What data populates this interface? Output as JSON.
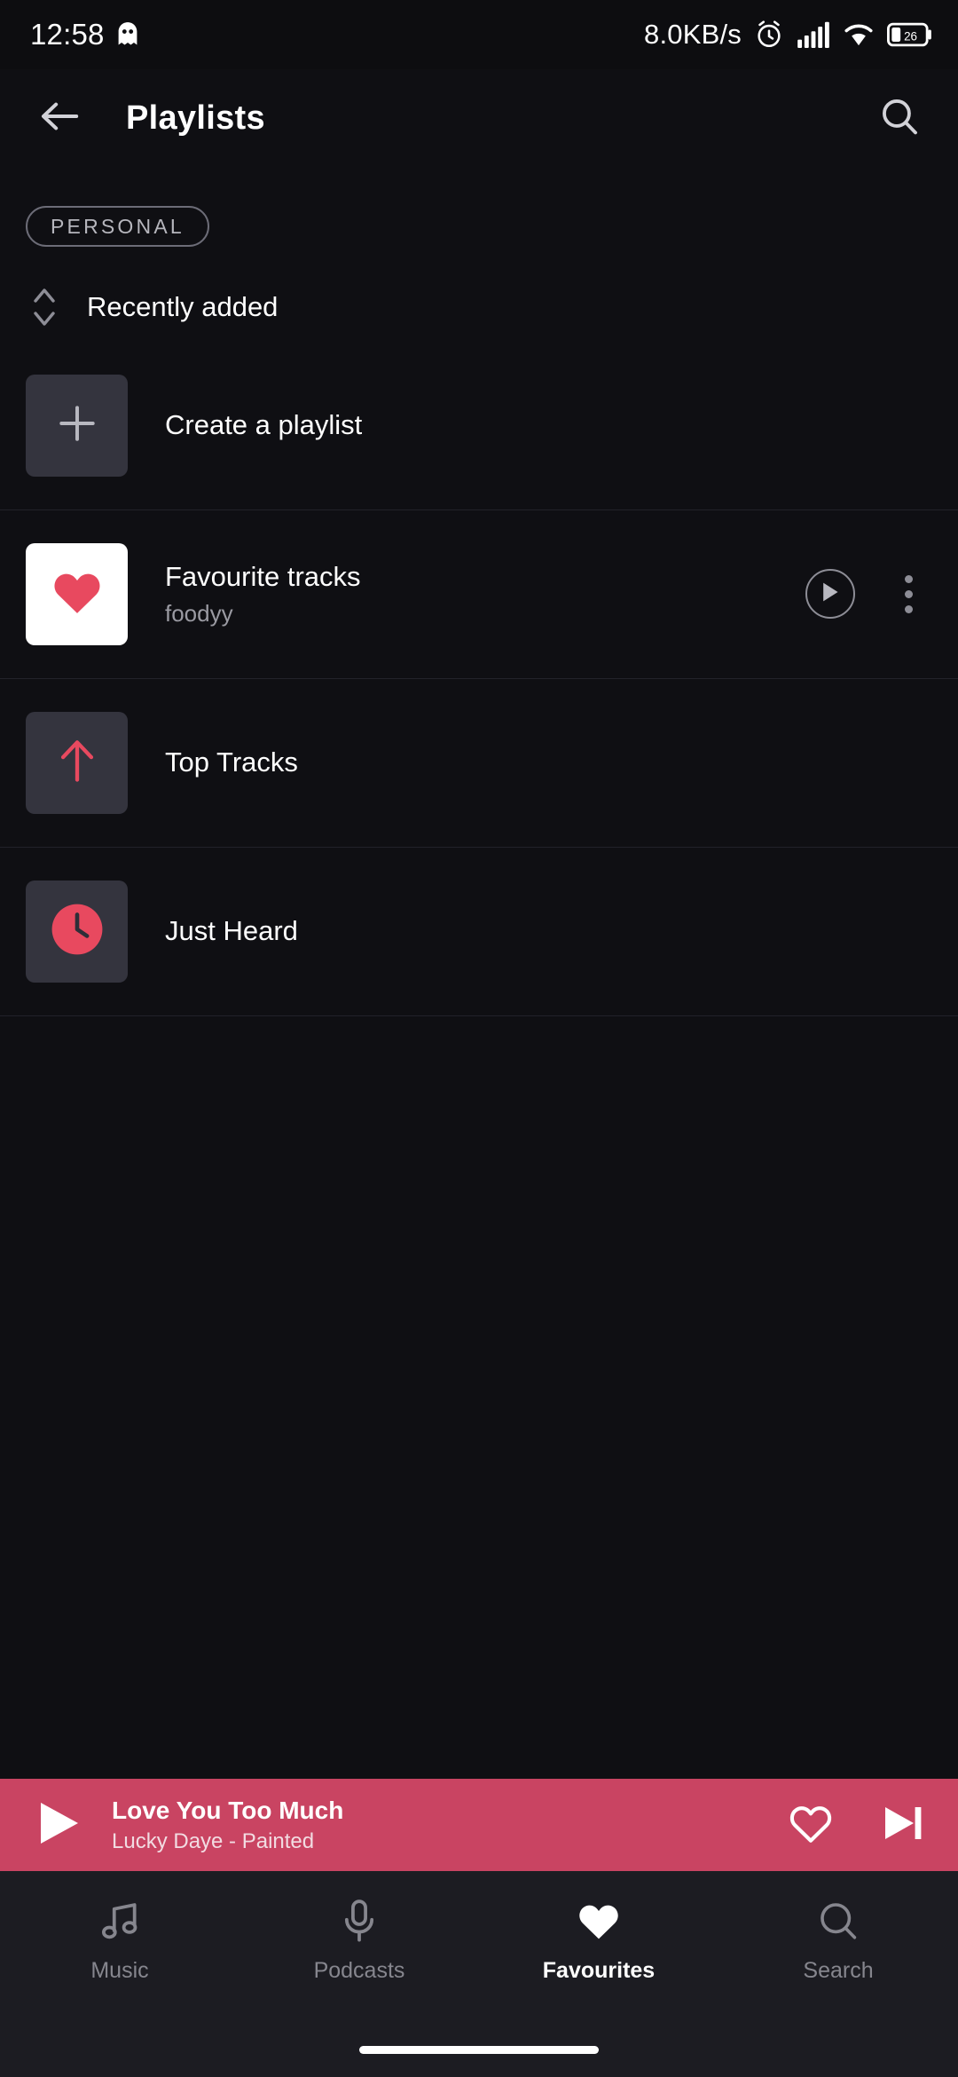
{
  "status_bar": {
    "time": "12:58",
    "network_speed": "8.0KB/s",
    "battery_level": "26",
    "icons": [
      "ghost-icon",
      "alarm-icon",
      "signal-icon",
      "wifi-icon",
      "battery-icon"
    ]
  },
  "app_bar": {
    "title": "Playlists",
    "back_icon": "arrow-left-icon",
    "search_icon": "search-icon"
  },
  "filters": {
    "chips": [
      {
        "label": "PERSONAL",
        "selected": true
      }
    ]
  },
  "sort": {
    "label": "Recently added",
    "icon": "sort-updown-icon"
  },
  "playlists": [
    {
      "title": "Create a playlist",
      "subtitle": "",
      "thumb_icon": "plus-icon",
      "thumb_style": "dark",
      "has_play": false,
      "has_menu": false
    },
    {
      "title": "Favourite tracks",
      "subtitle": "foodyy",
      "thumb_icon": "heart-icon",
      "thumb_style": "white",
      "has_play": true,
      "has_menu": true
    },
    {
      "title": "Top Tracks",
      "subtitle": "",
      "thumb_icon": "arrow-up-icon",
      "thumb_style": "dark",
      "has_play": false,
      "has_menu": false
    },
    {
      "title": "Just Heard",
      "subtitle": "",
      "thumb_icon": "clock-icon",
      "thumb_style": "dark",
      "has_play": false,
      "has_menu": false
    }
  ],
  "now_playing": {
    "title": "Love You Too Much",
    "subtitle": "Lucky Daye - Painted",
    "play_icon": "play-icon",
    "favourite_icon": "heart-outline-icon",
    "next_icon": "skip-next-icon",
    "accent_color": "#c94462"
  },
  "bottom_nav": {
    "items": [
      {
        "label": "Music",
        "icon": "music-note-icon",
        "active": false
      },
      {
        "label": "Podcasts",
        "icon": "microphone-icon",
        "active": false
      },
      {
        "label": "Favourites",
        "icon": "heart-filled-icon",
        "active": true
      },
      {
        "label": "Search",
        "icon": "search-icon",
        "active": false
      }
    ]
  },
  "colors": {
    "background": "#0f0f13",
    "accent_pink": "#e8495f",
    "player_bar": "#c94462",
    "nav_background": "#1c1c22",
    "thumb_dark": "#34343e"
  }
}
